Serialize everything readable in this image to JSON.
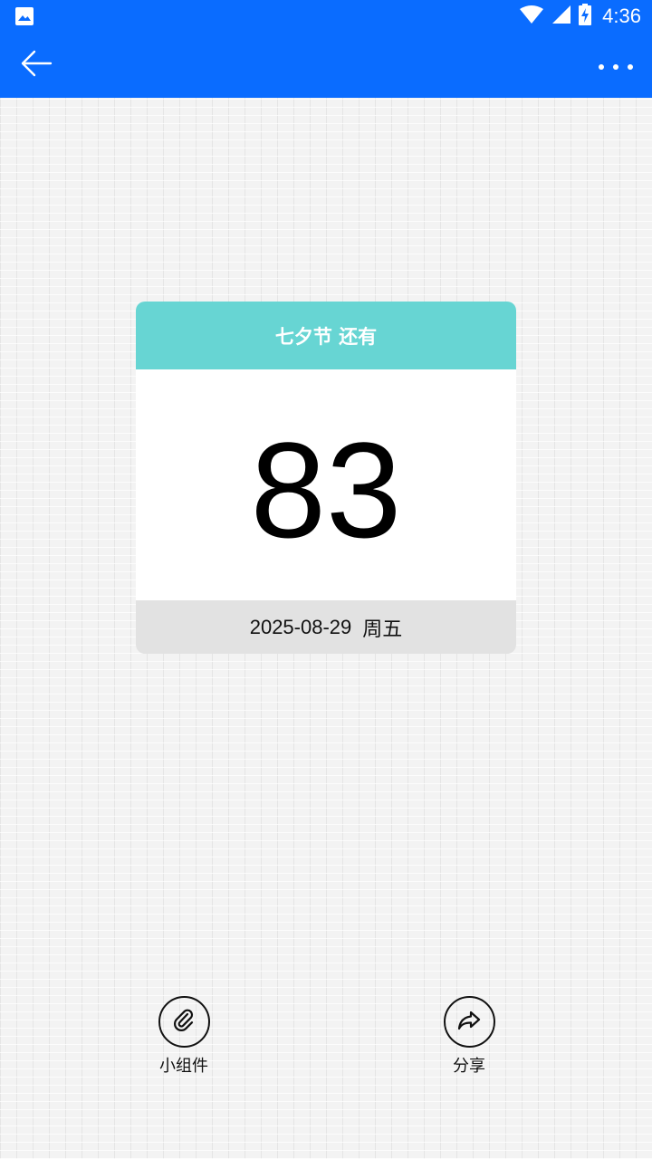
{
  "status_bar": {
    "time": "4:36",
    "icons": [
      "image-icon",
      "wifi-icon",
      "signal-icon",
      "battery-charging-icon"
    ]
  },
  "app_bar": {
    "back_icon": "arrow-left-icon",
    "more_icon": "more-horizontal-icon"
  },
  "card": {
    "header": "七夕节 还有",
    "count": "83",
    "date": "2025-08-29",
    "weekday": "周五"
  },
  "actions": {
    "widget_label": "小组件",
    "share_label": "分享"
  },
  "colors": {
    "primary": "#0a6cff",
    "card_header": "#67d5d3",
    "card_footer": "#e2e2e2"
  }
}
